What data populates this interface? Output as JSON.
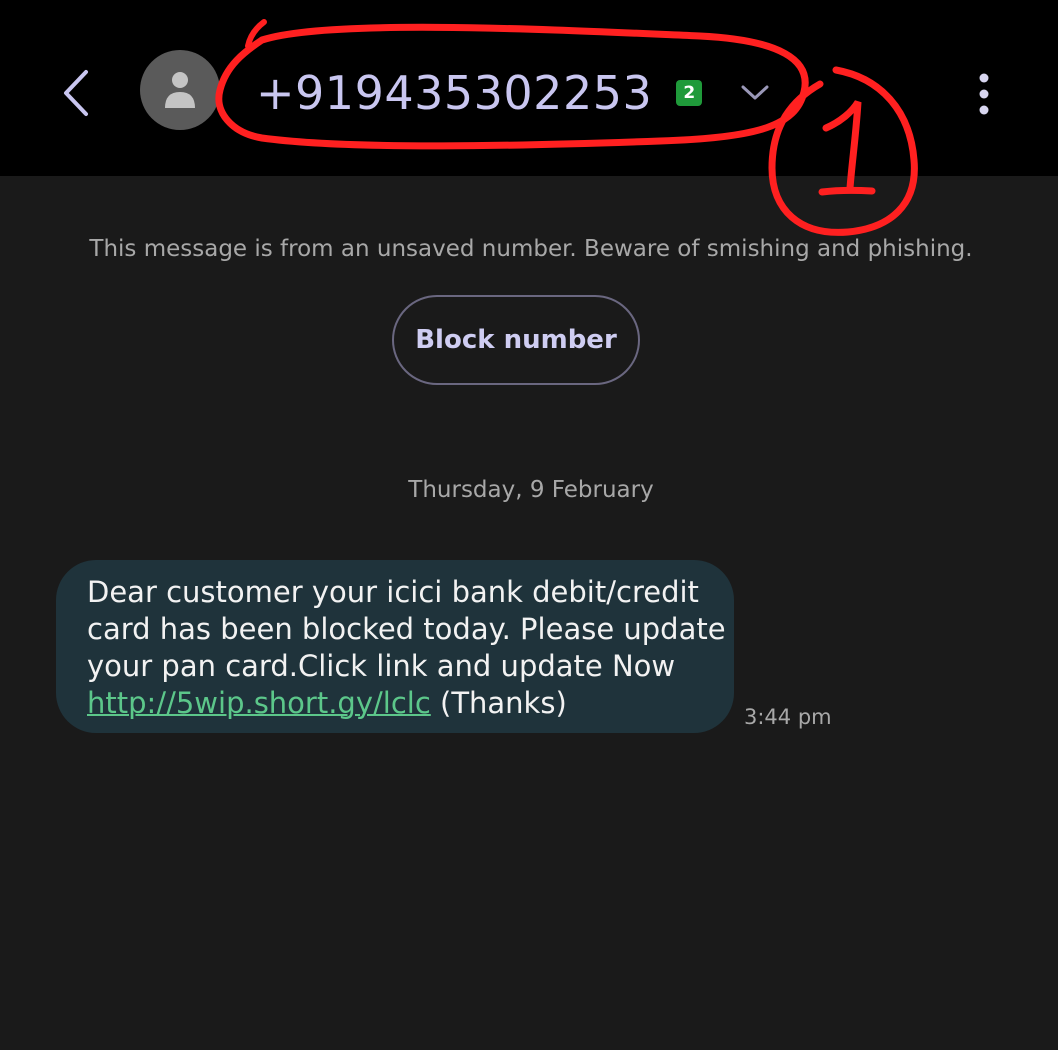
{
  "header": {
    "phone_number": "+919435302253",
    "sim_badge": "2",
    "icons": {
      "back": "back-arrow-icon",
      "avatar": "person-icon",
      "expand": "chevron-down-icon",
      "more": "more-vert-icon"
    }
  },
  "annotation": {
    "label": "1",
    "color": "#ff2020"
  },
  "conversation": {
    "warning_text": "This message is from an unsaved number. Beware of smishing and phishing.",
    "block_button_label": "Block number",
    "date_separator": "Thursday, 9 February",
    "messages": [
      {
        "line1": "Dear customer your icici bank debit/credit",
        "line2": "card has been blocked today. Please update",
        "line3": "your pan card.Click link and update Now",
        "link": "http://5wip.short.gy/lclc",
        "suffix": " (Thanks)",
        "time": "3:44 pm"
      }
    ]
  },
  "colors": {
    "background": "#1a1a1a",
    "header_bg": "#000000",
    "title": "#c9c6f0",
    "bubble_bg": "#1f333b",
    "link": "#5cc78a",
    "sim_badge": "#1f9a3a"
  }
}
